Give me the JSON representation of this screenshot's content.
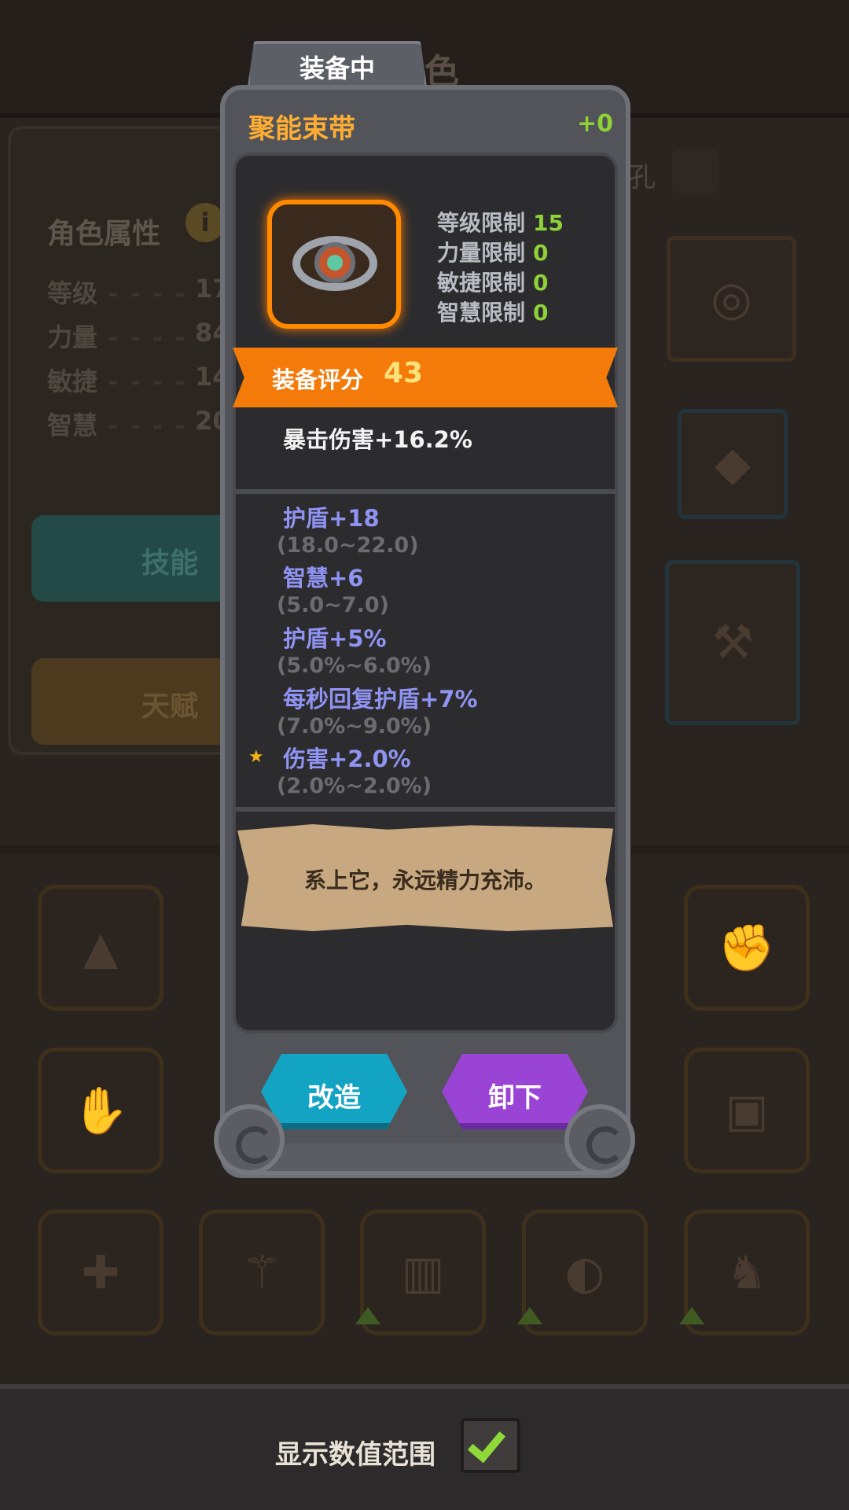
{
  "background": {
    "header_title": "色",
    "attributes_title": "角色属性",
    "info_icon": "i",
    "stats": [
      {
        "label": "等级",
        "value": "17"
      },
      {
        "label": "力量",
        "value": "84"
      },
      {
        "label": "敏捷",
        "value": "14"
      },
      {
        "label": "智慧",
        "value": "20"
      }
    ],
    "skill_button": "技能",
    "talent_button": "天赋",
    "socket_label": "孔"
  },
  "popup": {
    "tab_label": "装备中",
    "item_name": "聚能束带",
    "enhance_level": "+0",
    "item_icon": "ring-icon",
    "requirements": [
      {
        "label": "等级限制",
        "value": "15"
      },
      {
        "label": "力量限制",
        "value": "0"
      },
      {
        "label": "敏捷限制",
        "value": "0"
      },
      {
        "label": "智慧限制",
        "value": "0"
      }
    ],
    "score_label": "装备评分",
    "score_value": "43",
    "base_stat": "暴击伤害+16.2%",
    "affixes": [
      {
        "text": "护盾+18",
        "range": "(18.0~22.0)",
        "starred": false
      },
      {
        "text": "智慧+6",
        "range": "(5.0~7.0)",
        "starred": false
      },
      {
        "text": "护盾+5%",
        "range": "(5.0%~6.0%)",
        "starred": false
      },
      {
        "text": "每秒回复护盾+7%",
        "range": "(7.0%~9.0%)",
        "starred": false
      },
      {
        "text": "伤害+2.0%",
        "range": "(2.0%~2.0%)",
        "starred": true
      }
    ],
    "star_icon": "★",
    "flavor_text": "系上它，永远精力充沛。",
    "reforge_button": "改造",
    "unequip_button": "卸下"
  },
  "bottom_bar": {
    "show_range_label": "显示数值范围",
    "show_range_checked": true
  },
  "colors": {
    "item_name": "#ffae33",
    "requirement_value": "#8ed238",
    "score_banner": "#f47b0a",
    "affix": "#8f93f2",
    "range": "#6b6c70",
    "reforge_button": "#13a4c4",
    "unequip_button": "#9a44d6"
  }
}
